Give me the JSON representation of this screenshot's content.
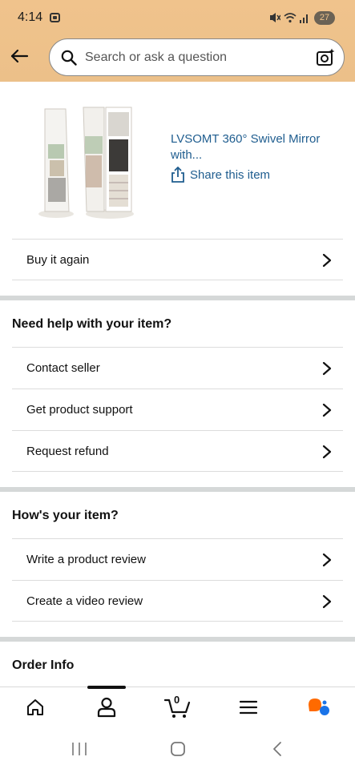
{
  "status_bar": {
    "time": "4:14",
    "battery": "27"
  },
  "search": {
    "placeholder": "Search or ask a question"
  },
  "product": {
    "title": "LVSOMT 360° Swivel Mirror with...",
    "share_label": "Share this item"
  },
  "buy_again": {
    "label": "Buy it again"
  },
  "help_section": {
    "title": "Need help with your item?",
    "items": [
      {
        "label": "Contact seller"
      },
      {
        "label": "Get product support"
      },
      {
        "label": "Request refund"
      }
    ]
  },
  "review_section": {
    "title": "How's your item?",
    "items": [
      {
        "label": "Write a product review"
      },
      {
        "label": "Create a video review"
      }
    ]
  },
  "order_info": {
    "title": "Order Info"
  },
  "bottom_nav": {
    "cart_count": "0",
    "items": [
      "home-icon",
      "account-icon",
      "cart-icon",
      "menu-icon",
      "rufus-icon"
    ],
    "active": "account-icon"
  },
  "colors": {
    "header_bg": "#f0c38c",
    "link": "#1f5d8f",
    "divider": "#d5d8d8",
    "rufus_orange": "#ff6a00",
    "rufus_blue": "#1a73e8"
  }
}
